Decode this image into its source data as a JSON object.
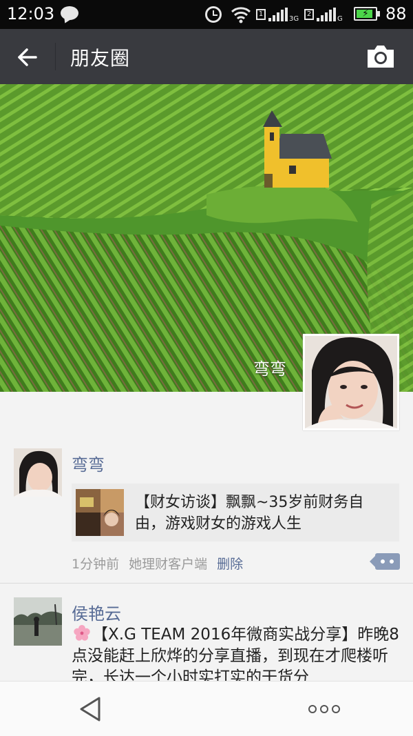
{
  "status_bar": {
    "time": "12:03",
    "sim1_label": "1",
    "sim1_network": "3G",
    "sim2_label": "2",
    "sim2_network": "G",
    "battery_percent": "88",
    "battery_level": 0.88,
    "icons": [
      "chat-notification-icon",
      "alarm-icon",
      "wifi-icon",
      "signal-icon",
      "battery-charging-icon"
    ]
  },
  "header": {
    "title": "朋友圈",
    "back_icon": "arrow-left-icon",
    "camera_icon": "camera-icon"
  },
  "cover": {
    "user_name": "弯弯"
  },
  "feed": [
    {
      "author": "弯弯",
      "link_title": "【财女访谈】飘飘~35岁前财务自由，游戏财女的游戏人生",
      "time_ago": "1分钟前",
      "source": "她理财客户端",
      "delete_label": "删除"
    },
    {
      "author": "侯艳云",
      "text": "【X.G TEAM 2016年微商实战分享】昨晚8点没能赶上欣烨的分享直播，到现在才爬楼听完，长达一个小时实打实的干货分"
    }
  ],
  "navbar": {
    "back_icon": "triangle-back-icon",
    "more_icon": "more-dots-icon"
  },
  "colors": {
    "title_bar": "#393a3f",
    "link_blue": "#576b95",
    "feed_bg": "#f3f3f3"
  }
}
